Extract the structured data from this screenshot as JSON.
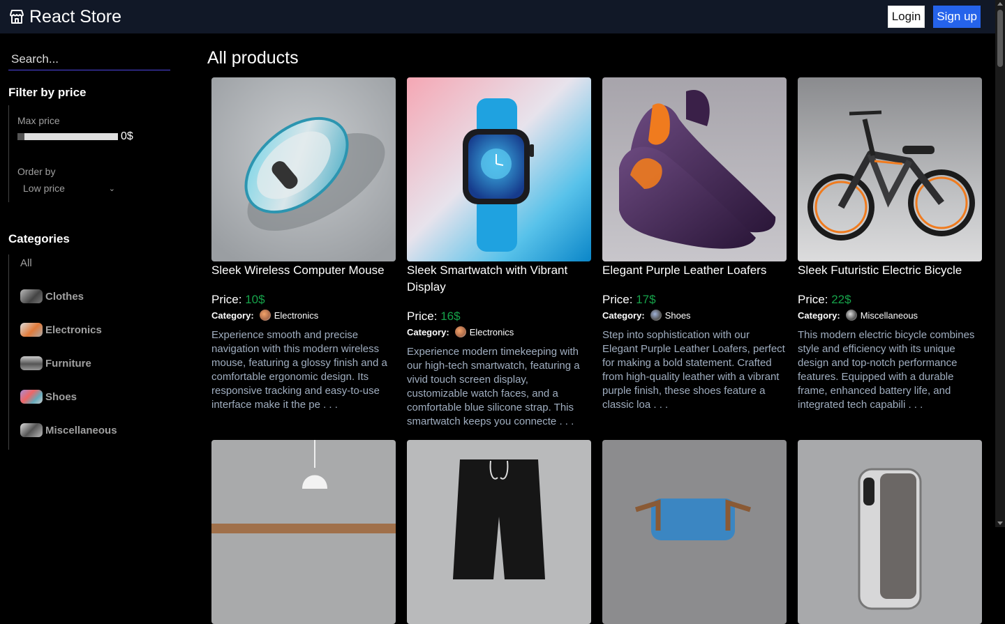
{
  "header": {
    "title": "React Store",
    "login_label": "Login",
    "signup_label": "Sign up"
  },
  "sidebar": {
    "search_placeholder": "Search...",
    "filter_title": "Filter by price",
    "max_price_label": "Max price",
    "max_price_value": "0$",
    "order_label": "Order by",
    "order_value": "Low price",
    "categories_title": "Categories",
    "categories": [
      {
        "label": "All"
      },
      {
        "label": "Clothes"
      },
      {
        "label": "Electronics"
      },
      {
        "label": "Furniture"
      },
      {
        "label": "Shoes"
      },
      {
        "label": "Miscellaneous"
      }
    ]
  },
  "main": {
    "title": "All products",
    "price_prefix": "Price: ",
    "category_label": "Category:",
    "products": [
      {
        "title": "Sleek Wireless Computer Mouse",
        "price": "10$",
        "category": "Electronics",
        "description": "Experience smooth and precise navigation with this modern wireless mouse, featuring a glossy finish and a comfortable ergonomic design. Its responsive tracking and easy-to-use interface make it the pe . . ."
      },
      {
        "title": "Sleek Smartwatch with Vibrant Display",
        "price": "16$",
        "category": "Electronics",
        "description": "Experience modern timekeeping with our high-tech smartwatch, featuring a vivid touch screen display, customizable watch faces, and a comfortable blue silicone strap. This smartwatch keeps you connecte . . ."
      },
      {
        "title": "Elegant Purple Leather Loafers",
        "price": "17$",
        "category": "Shoes",
        "description": "Step into sophistication with our Elegant Purple Leather Loafers, perfect for making a bold statement. Crafted from high-quality leather with a vibrant purple finish, these shoes feature a classic loa . . ."
      },
      {
        "title": "Sleek Futuristic Electric Bicycle",
        "price": "22$",
        "category": "Miscellaneous",
        "description": "This modern electric bicycle combines style and efficiency with its unique design and top-notch performance features. Equipped with a durable frame, enhanced battery life, and integrated tech capabili . . ."
      }
    ]
  }
}
